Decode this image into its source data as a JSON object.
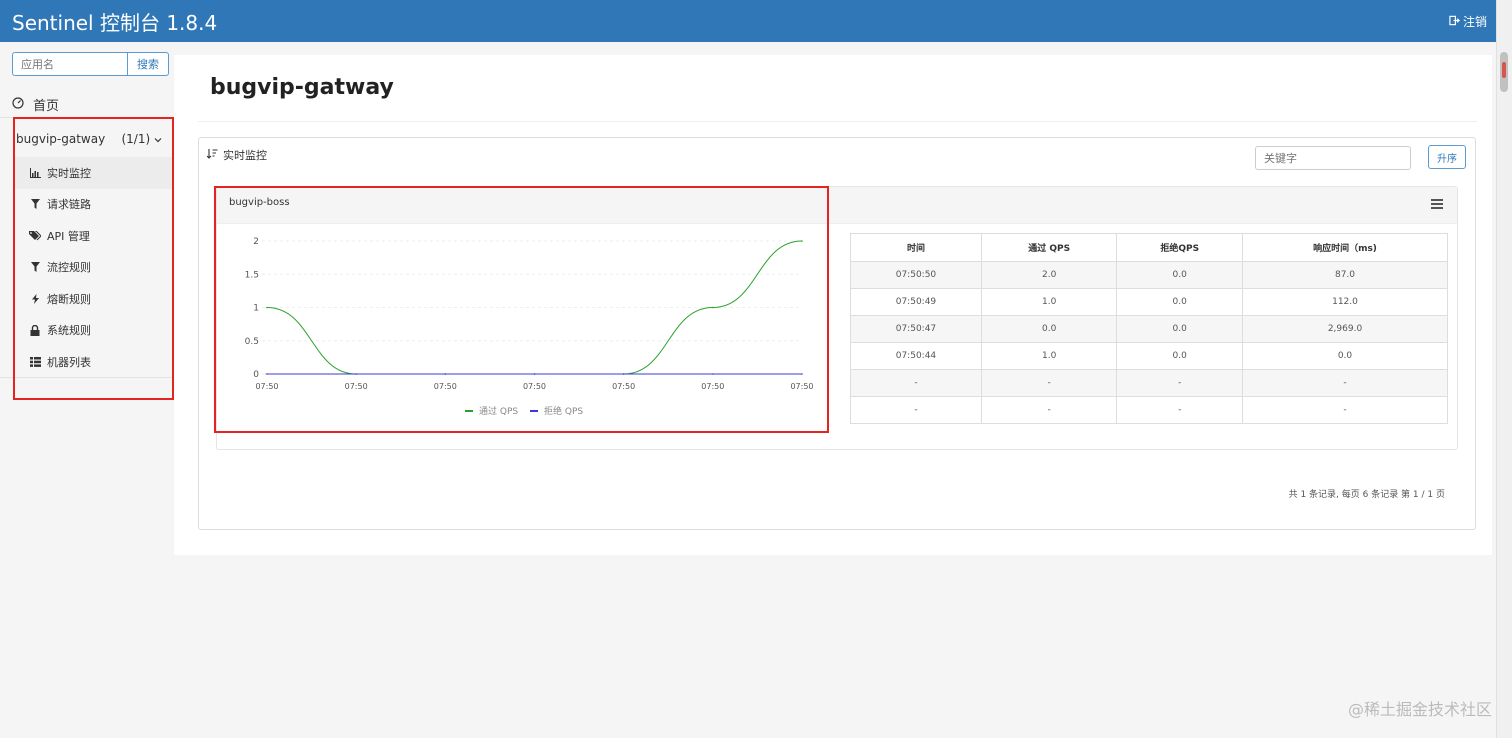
{
  "header": {
    "brand": "Sentinel 控制台 1.8.4",
    "logout_label": "注销"
  },
  "sidebar": {
    "app_search_placeholder": "应用名",
    "search_button": "搜索",
    "home_label": "首页",
    "app": {
      "name": "bugvip-gatway",
      "count": "(1/1)"
    },
    "menu": [
      {
        "icon": "bar-chart-icon",
        "label": "实时监控"
      },
      {
        "icon": "filter-icon",
        "label": "请求链路"
      },
      {
        "icon": "tags-icon",
        "label": "API 管理"
      },
      {
        "icon": "filter-icon",
        "label": "流控规则"
      },
      {
        "icon": "flash-icon",
        "label": "熔断规则"
      },
      {
        "icon": "lock-icon",
        "label": "系统规则"
      },
      {
        "icon": "list-icon",
        "label": "机器列表"
      }
    ]
  },
  "main": {
    "title": "bugvip-gatway",
    "panel_title": "实时监控",
    "keyword_placeholder": "关键字",
    "sort_button": "升序",
    "resource_name": "bugvip-boss",
    "table": {
      "headers": [
        "时间",
        "通过 QPS",
        "拒绝QPS",
        "响应时间（ms)"
      ],
      "rows": [
        [
          "07:50:50",
          "2.0",
          "0.0",
          "87.0"
        ],
        [
          "07:50:49",
          "1.0",
          "0.0",
          "112.0"
        ],
        [
          "07:50:47",
          "0.0",
          "0.0",
          "2,969.0"
        ],
        [
          "07:50:44",
          "1.0",
          "0.0",
          "0.0"
        ],
        [
          "-",
          "-",
          "-",
          "-"
        ],
        [
          "-",
          "-",
          "-",
          "-"
        ]
      ]
    },
    "pagination": "共 1 条记录, 每页 6 条记录 第 1 / 1 页"
  },
  "watermark": "@稀土掘金技术社区",
  "colors": {
    "header": "#2f77b7",
    "pass_series": "#2ca02c",
    "block_series": "#3b3bd6",
    "highlight": "#e52320"
  },
  "chart_data": {
    "type": "line",
    "x": [
      "07:50",
      "07:50",
      "07:50",
      "07:50",
      "07:50",
      "07:50",
      "07:50"
    ],
    "yticks": [
      "2",
      "1.5",
      "1",
      "0.5",
      "0"
    ],
    "ylim": [
      0,
      2
    ],
    "series": [
      {
        "name": "通过 QPS",
        "values": [
          1,
          0,
          0,
          0,
          0,
          1,
          2
        ],
        "color": "#2ca02c"
      },
      {
        "name": "拒绝 QPS",
        "values": [
          0,
          0,
          0,
          0,
          0,
          0,
          0
        ],
        "color": "#3b3bd6"
      }
    ],
    "legend": "bottom",
    "grid": true
  }
}
